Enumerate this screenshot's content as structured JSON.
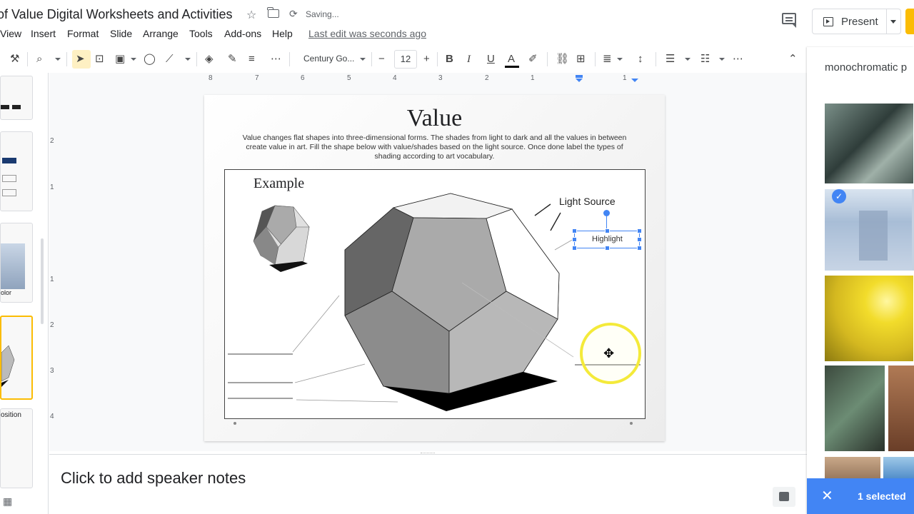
{
  "header": {
    "doc_title": "of Value Digital Worksheets and Activities",
    "status": "Saving...",
    "present_label": "Present"
  },
  "menu": {
    "items": [
      "View",
      "Insert",
      "Format",
      "Slide",
      "Arrange",
      "Tools",
      "Add-ons",
      "Help"
    ],
    "last_edit": "Last edit was seconds ago"
  },
  "toolbar": {
    "font_name": "Century Go...",
    "font_size": "12",
    "minus": "−",
    "plus": "+",
    "bold": "B",
    "italic": "I",
    "underline": "U",
    "text_color": "A"
  },
  "ruler": {
    "top": [
      "8",
      "7",
      "6",
      "5",
      "4",
      "3",
      "2",
      "1",
      "1"
    ],
    "left": [
      "2",
      "1",
      "1",
      "2",
      "3",
      "4"
    ]
  },
  "filmstrip": {
    "labels": [
      "olor",
      "osition"
    ]
  },
  "slide": {
    "title": "Value",
    "body": "Value changes flat shapes into three-dimensional forms. The shades from light to dark and all the values in between create value in art. Fill the shape below with value/shades based on the light source. Once done label the types of shading according to art vocabulary.",
    "example_label": "Example",
    "light_source_label": "Light Source",
    "highlight_label": "Highlight"
  },
  "explore": {
    "query": "monochromatic p",
    "selected_text": "1 selected"
  },
  "notes": {
    "placeholder": "Click to add speaker notes"
  },
  "colors": {
    "accent": "#4285f4",
    "share": "#fbbc04",
    "cursor_ring": "#f4ea3a"
  }
}
